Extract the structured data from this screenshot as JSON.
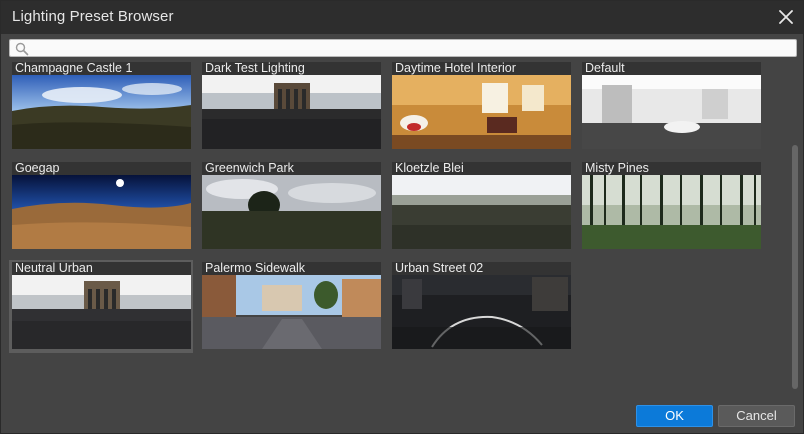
{
  "window": {
    "title": "Lighting Preset Browser"
  },
  "search": {
    "value": "",
    "placeholder": ""
  },
  "presets": [
    {
      "name": "Champagne Castle 1"
    },
    {
      "name": "Dark Test Lighting"
    },
    {
      "name": "Daytime Hotel Interior"
    },
    {
      "name": "Default"
    },
    {
      "name": "Goegap"
    },
    {
      "name": "Greenwich Park"
    },
    {
      "name": "Kloetzle Blei"
    },
    {
      "name": "Misty Pines"
    },
    {
      "name": "Neutral Urban",
      "selected": true
    },
    {
      "name": "Palermo Sidewalk"
    },
    {
      "name": "Urban Street 02"
    }
  ],
  "buttons": {
    "ok": "OK",
    "cancel": "Cancel"
  },
  "icons": {
    "close": "close-icon",
    "search": "search-icon"
  },
  "colors": {
    "accent": "#0c7ad9",
    "background": "#444444",
    "titlebar": "#2d2d2d"
  }
}
